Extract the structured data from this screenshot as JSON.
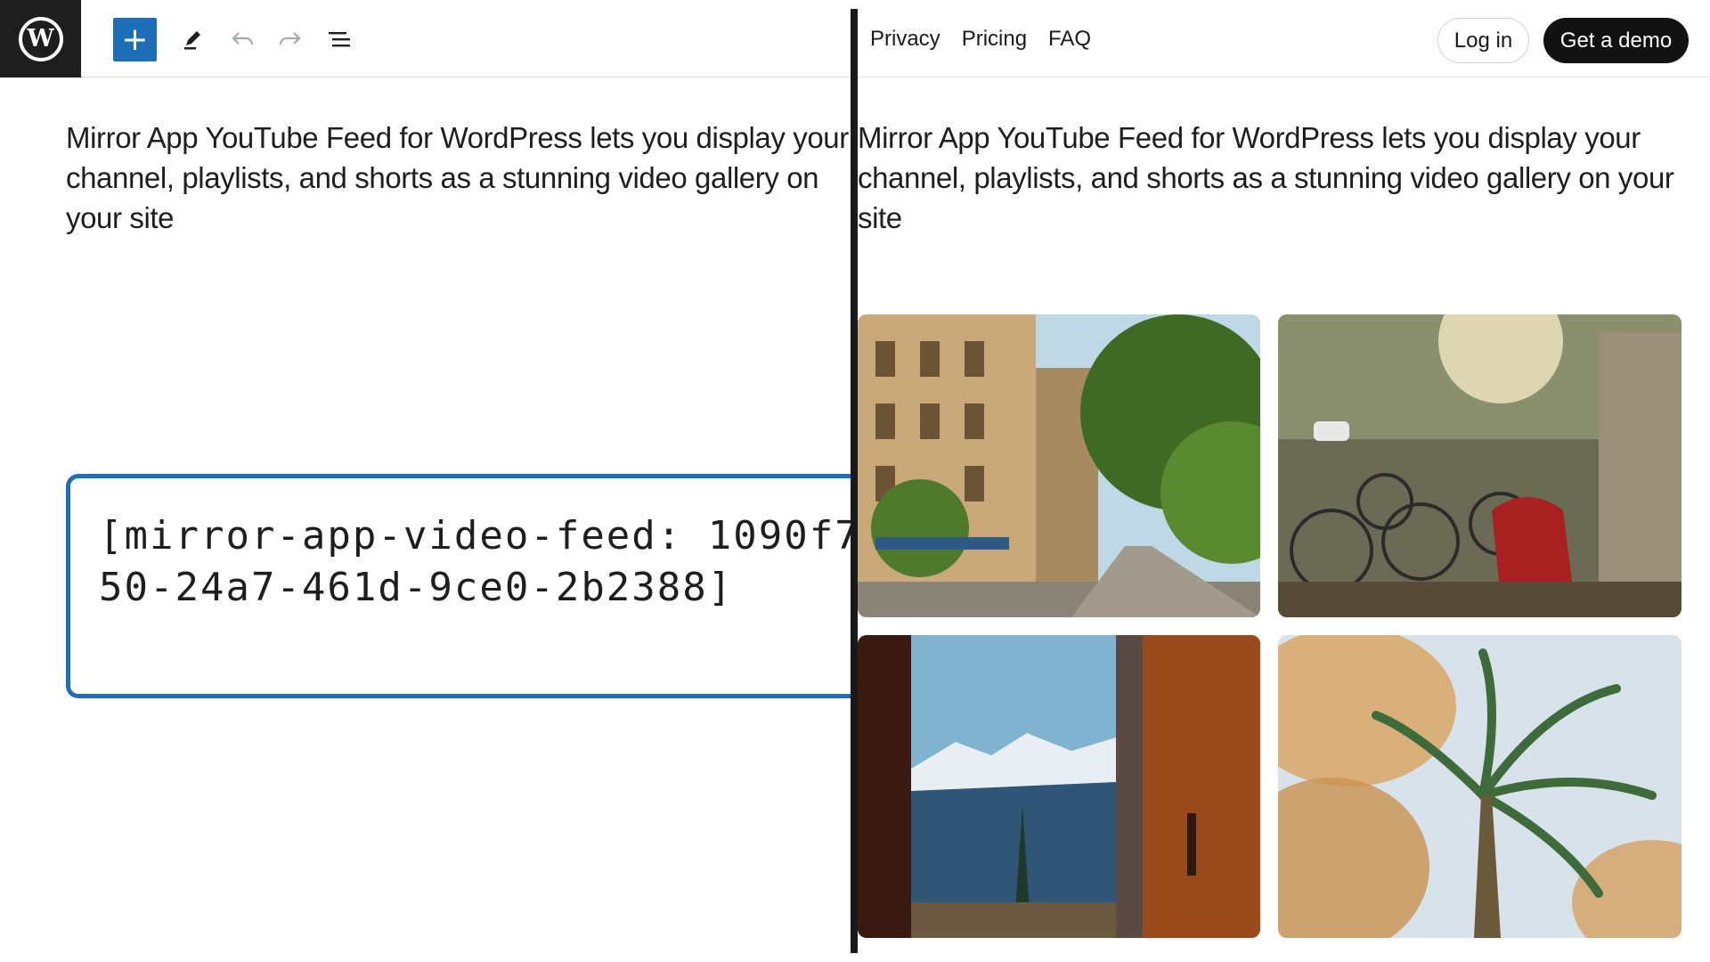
{
  "editor": {
    "toolbar": {
      "logo_icon": "wordpress-logo-icon",
      "add_icon": "plus-icon",
      "tools": [
        "pencil-icon",
        "undo-icon",
        "redo-icon",
        "list-view-icon"
      ]
    },
    "paragraph": "Mirror App YouTube Feed for WordPress lets you display your channel, playlists, and shorts as a stunning video gallery on your site",
    "shortcode": "[mirror-app-video-feed: 1090f750-24a7-461d-9ce0-2b2388]",
    "accent_color": "#1e6fb8"
  },
  "preview": {
    "nav": [
      "Privacy",
      "Pricing",
      "FAQ"
    ],
    "login_label": "Log in",
    "demo_label": "Get a demo",
    "paragraph": "Mirror App YouTube Feed for WordPress lets you display your channel, playlists, and shorts as a stunning video gallery on your site",
    "gallery": [
      {
        "subject": "city-street-photo"
      },
      {
        "subject": "bicycles-street-photo"
      },
      {
        "subject": "mountain-window-photo"
      },
      {
        "subject": "palm-tree-photo"
      }
    ]
  }
}
